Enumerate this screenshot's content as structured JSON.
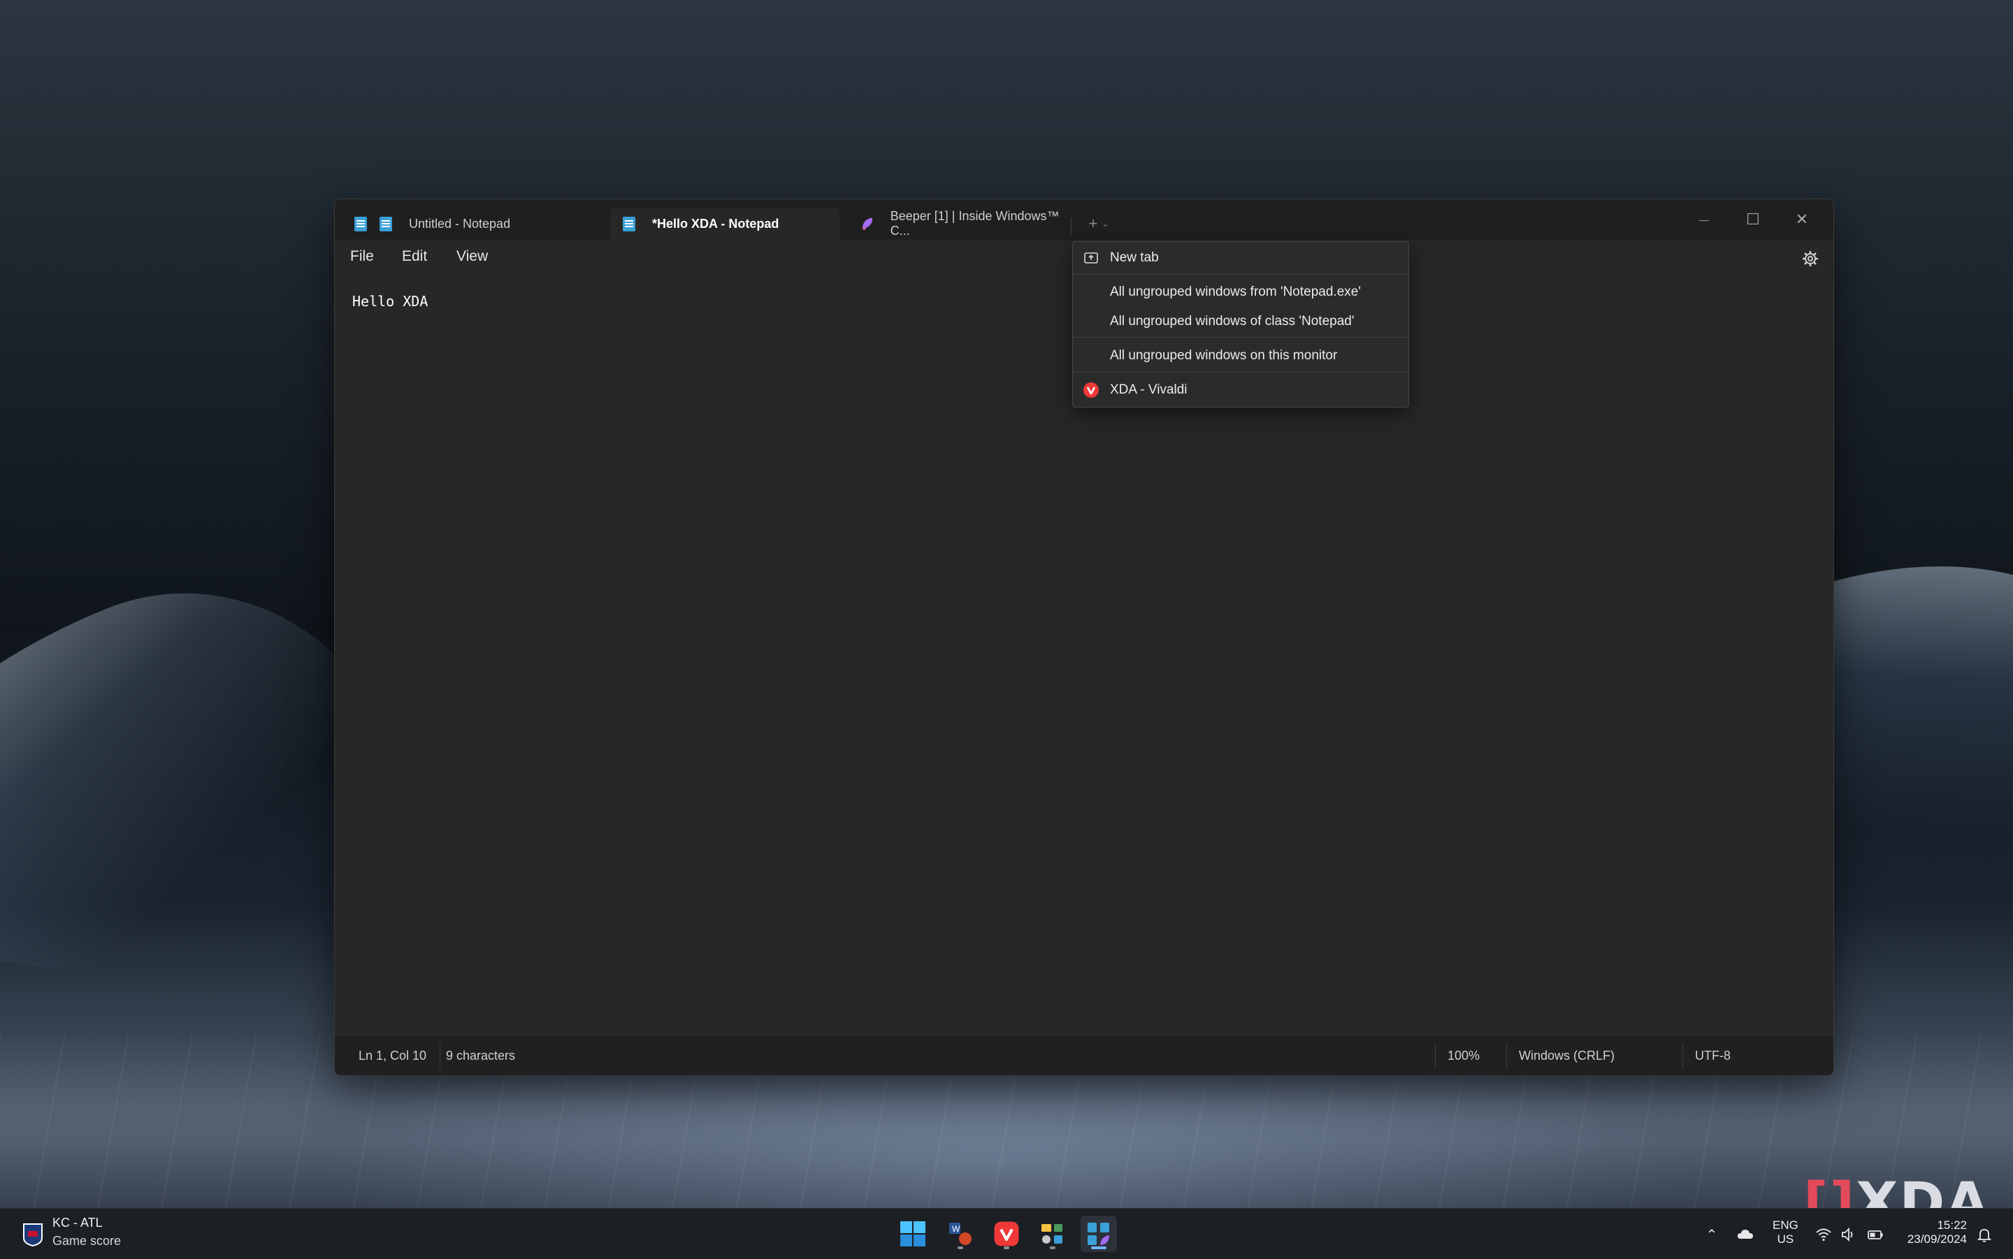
{
  "window": {
    "tabs": [
      {
        "label": "Untitled - Notepad",
        "active": false
      },
      {
        "label": "*Hello XDA - Notepad",
        "active": true
      },
      {
        "label": "Beeper [1] | Inside Windows™ C...",
        "active": false
      }
    ],
    "controls": {
      "minimize": "—",
      "maximize": "☐",
      "close": "✕"
    }
  },
  "menu": {
    "file": "File",
    "edit": "Edit",
    "view": "View"
  },
  "editor": {
    "content": "Hello XDA"
  },
  "status": {
    "position": "Ln 1, Col 10",
    "characters": "9 characters",
    "zoom": "100%",
    "line_ending": "Windows (CRLF)",
    "encoding": "UTF-8"
  },
  "dropdown": {
    "items": [
      {
        "label": "New tab",
        "icon": "new-tab-icon"
      },
      {
        "label": "All ungrouped windows from 'Notepad.exe'"
      },
      {
        "label": "All ungrouped windows of class 'Notepad'"
      },
      {
        "label": "All ungrouped windows on this monitor"
      },
      {
        "label": "XDA - Vivaldi",
        "icon": "vivaldi-icon"
      }
    ]
  },
  "taskbar": {
    "widget": {
      "title": "KC - ATL",
      "subtitle": "Game score"
    },
    "language": {
      "line1": "ENG",
      "line2": "US"
    },
    "clock": {
      "time": "15:22",
      "date": "23/09/2024"
    }
  },
  "watermark": {
    "text": "XDA"
  },
  "colors": {
    "accent": "#4cc2ff",
    "vivaldi": "#ef3939",
    "notepad": "#3aa0d8"
  }
}
